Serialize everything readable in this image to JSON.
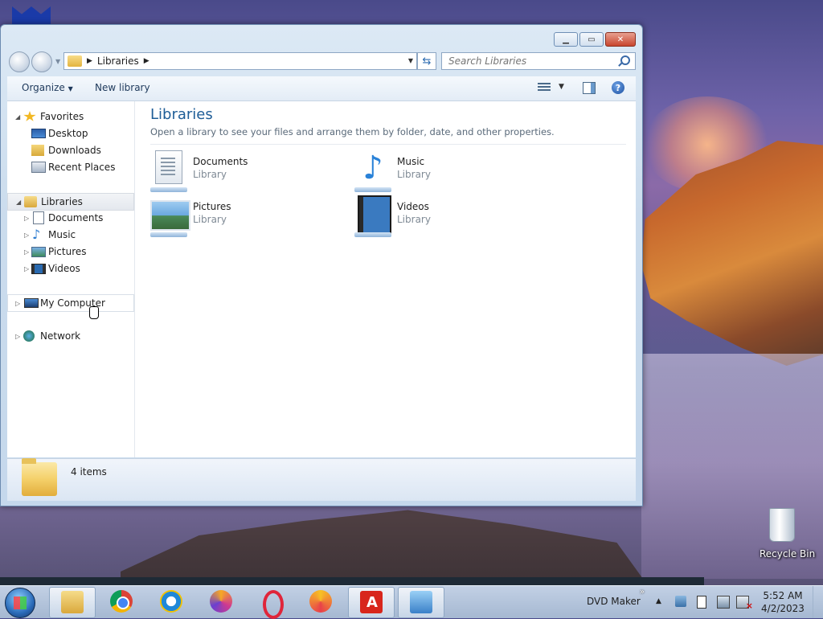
{
  "window": {
    "address": {
      "location": "Libraries",
      "search_placeholder": "Search Libraries"
    },
    "toolbar": {
      "organize_label": "Organize",
      "new_library_label": "New library"
    },
    "navigation": {
      "favorites": {
        "label": "Favorites",
        "items": [
          {
            "label": "Desktop",
            "icon": "desktop-icon"
          },
          {
            "label": "Downloads",
            "icon": "downloads-icon"
          },
          {
            "label": "Recent Places",
            "icon": "recent-places-icon"
          }
        ]
      },
      "libraries": {
        "label": "Libraries",
        "items": [
          {
            "label": "Documents",
            "icon": "documents-icon"
          },
          {
            "label": "Music",
            "icon": "music-icon"
          },
          {
            "label": "Pictures",
            "icon": "pictures-icon"
          },
          {
            "label": "Videos",
            "icon": "videos-icon"
          }
        ]
      },
      "computer": {
        "label": "My Computer"
      },
      "network": {
        "label": "Network"
      }
    },
    "main": {
      "title": "Libraries",
      "subtitle": "Open a library to see your files and arrange them by folder, date, and other properties.",
      "libraries": [
        {
          "name": "Documents",
          "type": "Library"
        },
        {
          "name": "Music",
          "type": "Library"
        },
        {
          "name": "Pictures",
          "type": "Library"
        },
        {
          "name": "Videos",
          "type": "Library"
        }
      ]
    },
    "status": {
      "item_count": "4 items"
    }
  },
  "desktop": {
    "recycle_bin_label": "Recycle Bin"
  },
  "taskbar": {
    "apps": [
      "windows-explorer",
      "google-chrome",
      "internet-explorer",
      "brave-browser",
      "opera-browser",
      "brave-browser-2",
      "avira-antivirus",
      "remote-desktop"
    ],
    "tray_label": "DVD Maker",
    "clock": {
      "time": "5:52 AM",
      "date": "4/2/2023"
    }
  },
  "colors": {
    "title_blue": "#1e5d97",
    "close_red": "#c8462e",
    "accent": "#2a82d8"
  }
}
